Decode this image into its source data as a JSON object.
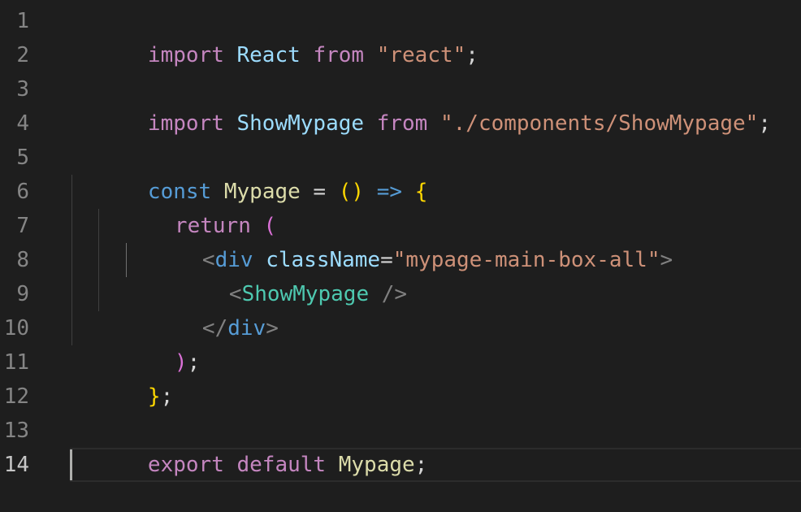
{
  "editor": {
    "line_numbers": [
      "1",
      "2",
      "3",
      "4",
      "5",
      "6",
      "7",
      "8",
      "9",
      "10",
      "11",
      "12",
      "13",
      "14"
    ],
    "active_line": "14",
    "line1": {
      "kw": "import",
      "sp1": " ",
      "name": "React",
      "sp2": " ",
      "from": "from",
      "sp3": " ",
      "str": "\"react\"",
      "semi": ";"
    },
    "line3": {
      "kw": "import",
      "sp1": " ",
      "name": "ShowMypage",
      "sp2": " ",
      "from": "from",
      "sp3": " ",
      "str": "\"./components/ShowMypage\"",
      "semi": ";"
    },
    "line5": {
      "kw": "const",
      "sp1": " ",
      "name": "Mypage",
      "eq": " = ",
      "parens": "()",
      "sp2": " ",
      "arrow": "=>",
      "sp3": " ",
      "brace": "{"
    },
    "line6": {
      "kw": "return",
      "sp": " ",
      "paren": "("
    },
    "line7": {
      "lt": "<",
      "tag": "div",
      "sp": " ",
      "attr": "className",
      "eq": "=",
      "str": "\"mypage-main-box-all\"",
      "gt": ">"
    },
    "line8": {
      "lt": "<",
      "comp": "ShowMypage",
      "close": " />"
    },
    "line9": {
      "lt": "</",
      "tag": "div",
      "gt": ">"
    },
    "line10": {
      "paren": ")",
      "semi": ";"
    },
    "line11": {
      "brace": "}",
      "semi": ";"
    },
    "line13": {
      "export": "export",
      "sp1": " ",
      "default": "default",
      "sp2": " ",
      "name": "Mypage",
      "semi": ";"
    }
  }
}
